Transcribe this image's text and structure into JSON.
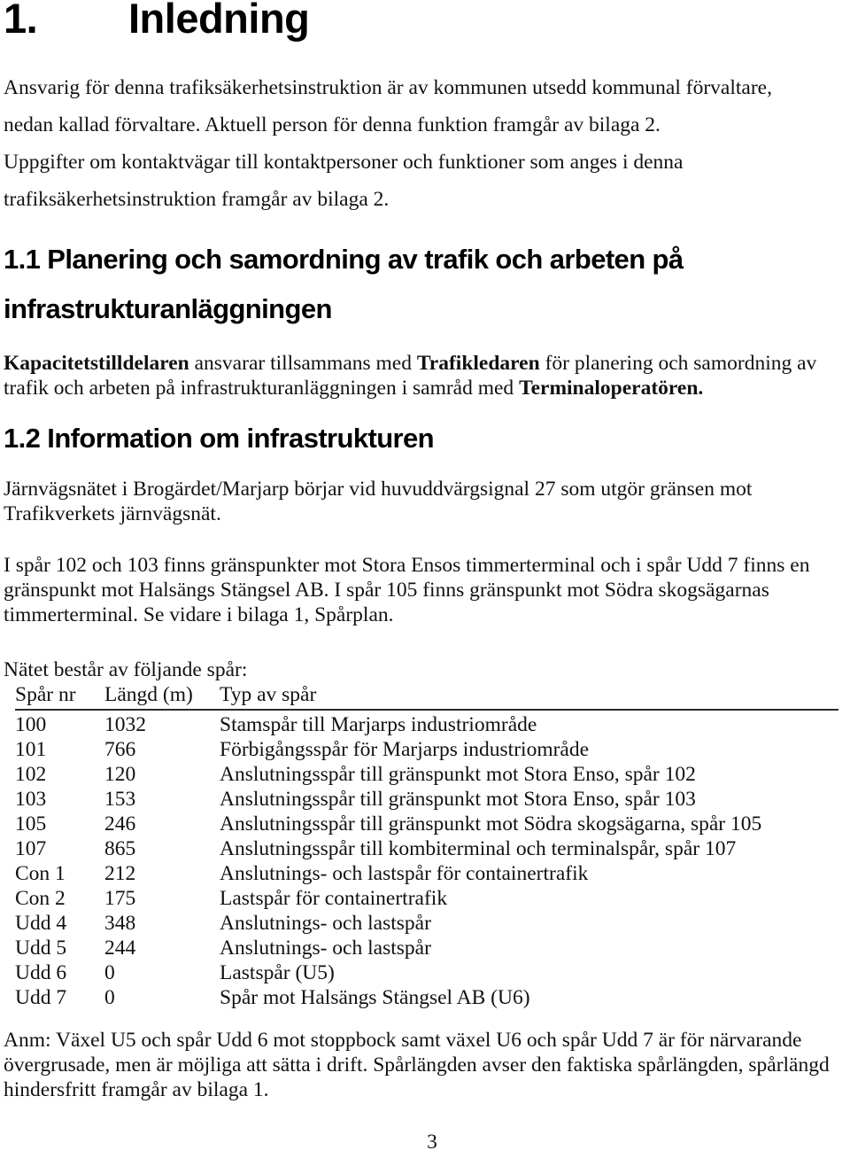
{
  "document": {
    "heading1": {
      "number": "1.",
      "title": "Inledning"
    },
    "intro_paragraph": {
      "line1": "Ansvarig för denna trafiksäkerhetsinstruktion är av kommunen utsedd kommunal förvaltare,",
      "line2": "nedan kallad förvaltare. Aktuell person för denna funktion framgår av bilaga 2.",
      "line3": "Uppgifter om kontaktvägar till kontaktpersoner och funktioner som anges i denna",
      "line4": "trafiksäkerhetsinstruktion framgår av bilaga 2."
    },
    "section_11": {
      "heading": "1.1 Planering och samordning av trafik och arbeten på infrastrukturanläggningen",
      "body": {
        "bold1": "Kapacitetstilldelaren",
        "text1": " ansvarar tillsammans med ",
        "bold2": "Trafikledaren",
        "text2": " för planering och samordning av trafik och arbeten på infrastrukturanläggningen i samråd med ",
        "bold3": "Terminaloperatören."
      }
    },
    "section_12": {
      "heading": "1.2 Information om infrastrukturen",
      "paragraph_a": "Järnvägsnätet i Brogärdet/Marjarp börjar vid huvuddvärgsignal 27 som utgör gränsen mot Trafikverkets järnvägsnät.",
      "paragraph_b": "I spår 102 och 103 finns gränspunkter mot Stora Ensos timmerterminal och i spår Udd 7 finns en gränspunkt mot Halsängs Stängsel AB. I spår 105 finns gränspunkt mot Södra skogsägarnas timmerterminal. Se vidare i bilaga 1, Spårplan.",
      "table_lead": "Nätet består av följande spår:",
      "note": "Anm: Växel U5 och spår Udd 6 mot stoppbock samt växel U6 och spår Udd 7 är för närvarande övergrusade, men är möjliga att sätta i drift. Spårlängden avser den faktiska spårlängden, spårlängd hindersfritt framgår av bilaga 1."
    },
    "track_table": {
      "columns": [
        "Spår nr",
        "Längd (m)",
        "Typ av spår"
      ],
      "rows": [
        {
          "nr": "100",
          "length": "1032",
          "type": "Stamspår till Marjarps industriområde"
        },
        {
          "nr": "101",
          "length": "766",
          "type": "Förbigångsspår för Marjarps industriområde"
        },
        {
          "nr": "102",
          "length": "120",
          "type": "Anslutningsspår till gränspunkt mot Stora Enso, spår 102"
        },
        {
          "nr": "103",
          "length": "153",
          "type": "Anslutningsspår till gränspunkt mot Stora Enso, spår 103"
        },
        {
          "nr": "105",
          "length": "246",
          "type": "Anslutningsspår till gränspunkt mot Södra skogsägarna, spår 105"
        },
        {
          "nr": "107",
          "length": "865",
          "type": "Anslutningsspår till kombiterminal och terminalspår, spår 107"
        },
        {
          "nr": "Con 1",
          "length": "212",
          "type": "Anslutnings- och lastspår för containertrafik"
        },
        {
          "nr": "Con 2",
          "length": "175",
          "type": "Lastspår för containertrafik"
        },
        {
          "nr": "Udd 4",
          "length": "348",
          "type": "Anslutnings- och lastspår"
        },
        {
          "nr": "Udd 5",
          "length": "244",
          "type": "Anslutnings- och lastspår"
        },
        {
          "nr": "Udd 6",
          "length": "0",
          "type": "Lastspår (U5)"
        },
        {
          "nr": "Udd 7",
          "length": "0",
          "type": "Spår mot Halsängs Stängsel AB (U6)"
        }
      ]
    },
    "page_number": "3"
  }
}
